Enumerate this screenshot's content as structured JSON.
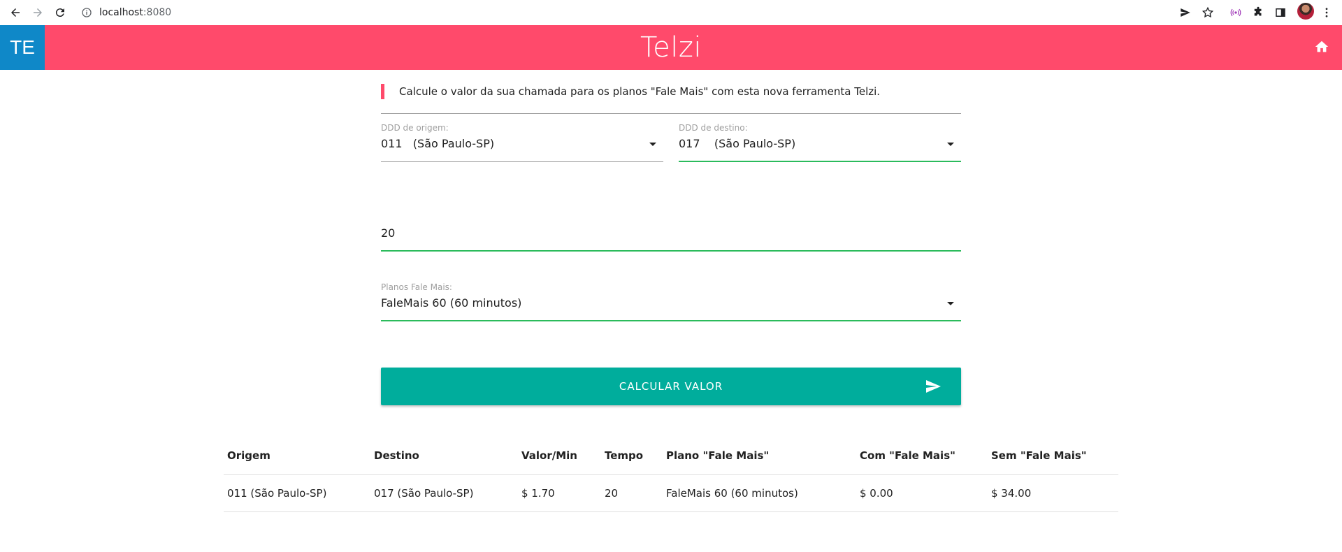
{
  "browser": {
    "url_host": "localhost",
    "url_port": ":8080"
  },
  "app": {
    "logo": "TE",
    "title": "Telzi",
    "header_color": "#ff4a6b",
    "logo_color": "#0f88c8",
    "home_icon": "home-icon"
  },
  "form": {
    "intro": "Calcule o valor da sua chamada para os planos \"Fale Mais\" com esta nova ferramenta Telzi.",
    "origin": {
      "label": "DDD de origem:",
      "value": "011   (São Paulo-SP)"
    },
    "destination": {
      "label": "DDD de destino:",
      "value": "017    (São Paulo-SP)"
    },
    "minutes": {
      "value": "20"
    },
    "plan": {
      "label": "Planos Fale Mais:",
      "value": "FaleMais 60 (60 minutos)"
    },
    "submit_label": "CALCULAR VALOR",
    "submit_icon": "send-icon",
    "accent_color": "#2bbb5c",
    "button_color": "#00ad9c"
  },
  "table": {
    "headers": [
      "Origem",
      "Destino",
      "Valor/Min",
      "Tempo",
      "Plano \"Fale Mais\"",
      "Com \"Fale Mais\"",
      "Sem \"Fale Mais\""
    ],
    "rows": [
      [
        "011 (São Paulo-SP)",
        "017 (São Paulo-SP)",
        "$ 1.70",
        "20",
        "FaleMais 60 (60 minutos)",
        "$ 0.00",
        "$ 34.00"
      ]
    ]
  }
}
